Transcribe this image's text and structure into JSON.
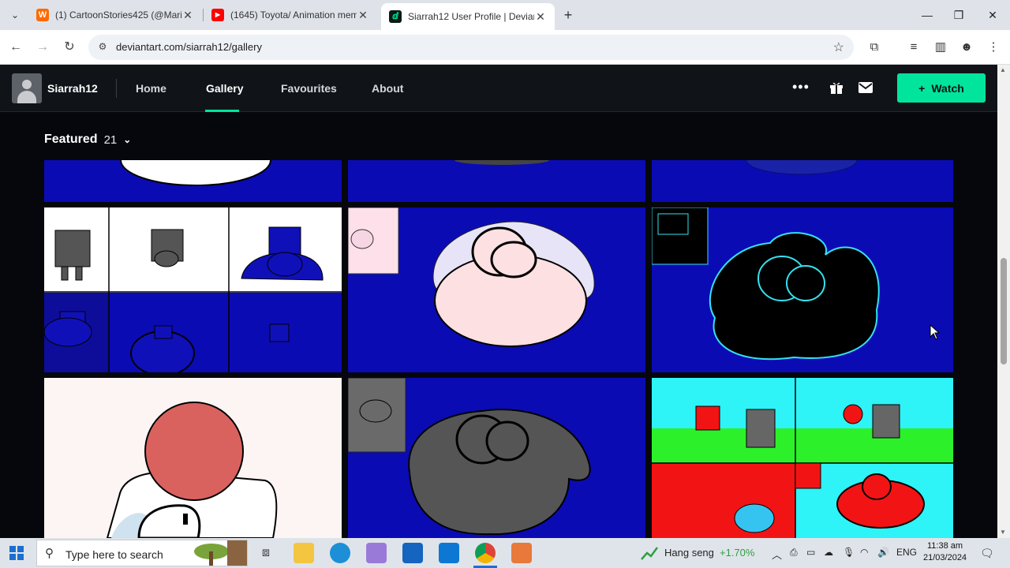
{
  "browser": {
    "tabs": [
      {
        "title": "(1) CartoonStories425 (@Maria…",
        "icon": "w-icon",
        "active": false
      },
      {
        "title": "(1645) Toyota/ Animation mem…",
        "icon": "youtube-icon",
        "active": false
      },
      {
        "title": "Siarrah12 User Profile | Devian…",
        "icon": "deviantart-icon",
        "active": true
      }
    ],
    "new_tab": "+",
    "url": "deviantart.com/siarrah12/gallery"
  },
  "site": {
    "username": "Siarrah12",
    "nav": [
      {
        "label": "Home"
      },
      {
        "label": "Gallery"
      },
      {
        "label": "Favourites"
      },
      {
        "label": "About"
      }
    ],
    "watch_label": "Watch",
    "section_title": "Featured",
    "section_count": "21",
    "accent": "#00e59b"
  },
  "taskbar": {
    "search_placeholder": "Type here to search",
    "stock_name": "Hang seng",
    "stock_change": "+1.70%",
    "language": "ENG",
    "time": "11:38 am",
    "date": "21/03/2024"
  }
}
